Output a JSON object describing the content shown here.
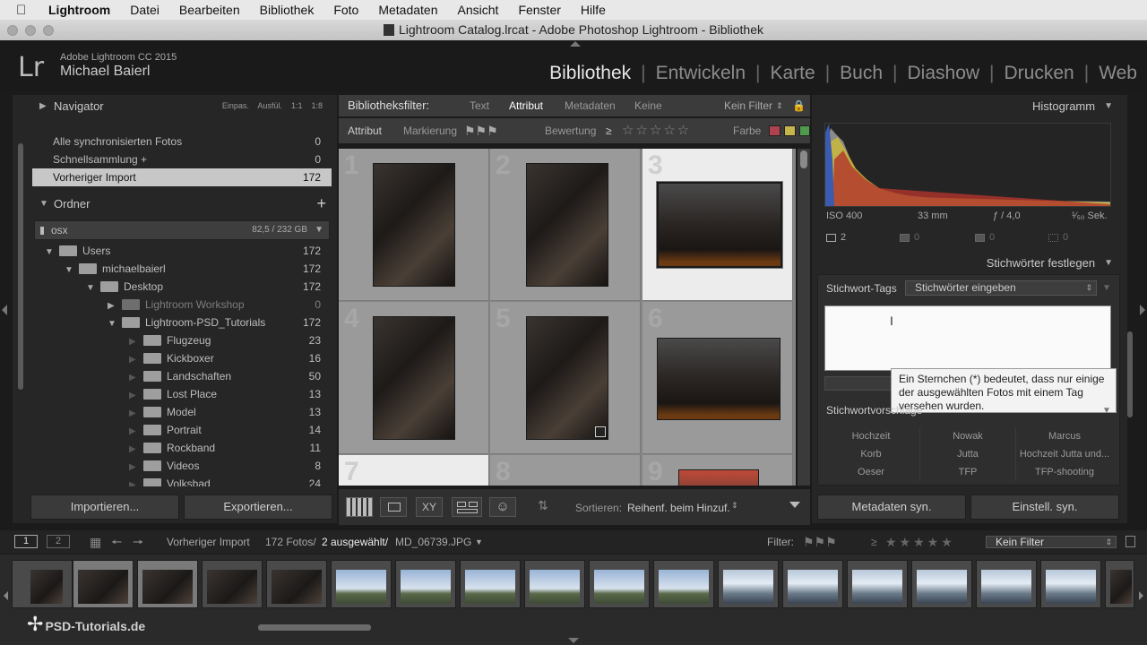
{
  "menubar": {
    "items": [
      "Lightroom",
      "Datei",
      "Bearbeiten",
      "Bibliothek",
      "Foto",
      "Metadaten",
      "Ansicht",
      "Fenster",
      "Hilfe"
    ]
  },
  "window": {
    "title": "Lightroom Catalog.lrcat - Adobe Photoshop Lightroom - Bibliothek"
  },
  "identity": {
    "logo": "Lr",
    "product": "Adobe Lightroom CC 2015",
    "user": "Michael Baierl"
  },
  "modules": [
    "Bibliothek",
    "Entwickeln",
    "Karte",
    "Buch",
    "Diashow",
    "Drucken",
    "Web"
  ],
  "navigator": {
    "title": "Navigator",
    "zooms": [
      "Einpas.",
      "Ausfül.",
      "1:1",
      "1:8"
    ]
  },
  "catalog": {
    "items": [
      {
        "label": "Alle synchronisierten Fotos",
        "count": "0"
      },
      {
        "label": "Schnellsammlung +",
        "count": "0"
      },
      {
        "label": "Vorheriger Import",
        "count": "172"
      }
    ]
  },
  "folders": {
    "title": "Ordner",
    "volume": {
      "name": "osx",
      "size": "82,5 / 232 GB"
    },
    "items": [
      {
        "label": "Users",
        "count": "172"
      },
      {
        "label": "michaelbaierl",
        "count": "172"
      },
      {
        "label": "Desktop",
        "count": "172"
      },
      {
        "label": "Lightroom Workshop",
        "count": "0"
      },
      {
        "label": "Lightroom-PSD_Tutorials",
        "count": "172"
      },
      {
        "label": "Flugzeug",
        "count": "23"
      },
      {
        "label": "Kickboxer",
        "count": "16"
      },
      {
        "label": "Landschaften",
        "count": "50"
      },
      {
        "label": "Lost Place",
        "count": "13"
      },
      {
        "label": "Model",
        "count": "13"
      },
      {
        "label": "Portrait",
        "count": "14"
      },
      {
        "label": "Rockband",
        "count": "11"
      },
      {
        "label": "Videos",
        "count": "8"
      },
      {
        "label": "Volksbad",
        "count": "24"
      }
    ]
  },
  "left_buttons": {
    "import": "Importieren...",
    "export": "Exportieren..."
  },
  "filterbar": {
    "label": "Bibliotheksfilter:",
    "tabs": [
      "Text",
      "Attribut",
      "Metadaten",
      "Keine"
    ],
    "preset": "Kein Filter",
    "attribute": "Attribut",
    "flag": "Markierung",
    "rating": "Bewertung",
    "rating_op": "≥",
    "color": "Farbe"
  },
  "grid": {
    "cell_numbers": [
      "1",
      "2",
      "3",
      "4",
      "5",
      "6",
      "7",
      "8",
      "9"
    ]
  },
  "toolbar": {
    "sort_label": "Sortieren:",
    "sort_value": "Reihenf. beim Hinzuf."
  },
  "histogram": {
    "title": "Histogramm",
    "iso": "ISO 400",
    "focal": "33 mm",
    "aperture": "ƒ / 4,0",
    "shutter": "¹⁄₅₀ Sek.",
    "count": "2",
    "c2": "0",
    "c3": "0",
    "c4": "0"
  },
  "keywording": {
    "title": "Stichwörter festlegen",
    "tags_label": "Stichwort-Tags",
    "tags_value": "Stichwörter eingeben",
    "tooltip": "Ein Sternchen (*) bedeutet, dass nur einige der ausgewählten Fotos mit einem Tag versehen wurden.",
    "suggestions_title": "Stichwortvorschläge",
    "suggestions": [
      "Hochzeit",
      "Nowak",
      "Marcus",
      "Korb",
      "Jutta",
      "Hochzeit Jutta und...",
      "Oeser",
      "TFP",
      "TFP-shooting"
    ]
  },
  "right_buttons": {
    "sync_meta": "Metadaten syn.",
    "sync_settings": "Einstell. syn."
  },
  "secondary": {
    "page1": "1",
    "page2": "2",
    "source": "Vorheriger Import",
    "count": "172 Fotos/",
    "selected": "2 ausgewählt/",
    "file": "MD_06739.JPG",
    "filter_label": "Filter:",
    "filter_value": "Kein Filter"
  },
  "watermark": "PSD-Tutorials.de",
  "colors": {
    "accent_red": "#c0392b",
    "label_red": "#b0414f",
    "label_yellow": "#c6b54a",
    "label_green": "#4f9a4d"
  }
}
